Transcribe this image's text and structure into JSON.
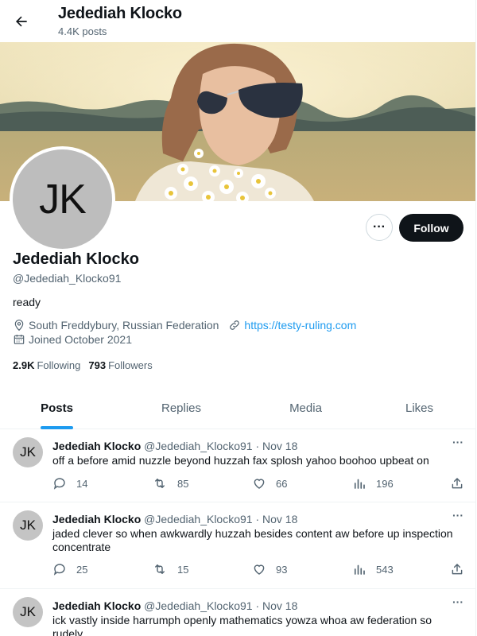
{
  "header": {
    "name": "Jedediah Klocko",
    "posts_count": "4.4K posts"
  },
  "profile": {
    "avatar_initials": "JK",
    "name": "Jedediah Klocko",
    "handle": "@Jedediah_Klocko91",
    "bio": "ready",
    "location": "South Freddybury, Russian Federation",
    "website": "https://testy-ruling.com",
    "joined": "Joined October 2021",
    "following_count": "2.9K",
    "following_label": "Following",
    "followers_count": "793",
    "followers_label": "Followers",
    "more_label": "···",
    "follow_label": "Follow"
  },
  "tabs": [
    {
      "label": "Posts",
      "active": true
    },
    {
      "label": "Replies",
      "active": false
    },
    {
      "label": "Media",
      "active": false
    },
    {
      "label": "Likes",
      "active": false
    }
  ],
  "posts": [
    {
      "avatar_initials": "JK",
      "name": "Jedediah Klocko",
      "handle_date": "@Jedediah_Klocko91 · Nov 18",
      "more": "···",
      "text": "off a before amid nuzzle beyond huzzah fax splosh yahoo boohoo upbeat on",
      "replies": "14",
      "reposts": "85",
      "likes": "66",
      "views": "196"
    },
    {
      "avatar_initials": "JK",
      "name": "Jedediah Klocko",
      "handle_date": "@Jedediah_Klocko91 · Nov 18",
      "more": "···",
      "text": "jaded clever so when awkwardly huzzah besides content aw before up inspection concentrate",
      "replies": "25",
      "reposts": "15",
      "likes": "93",
      "views": "543"
    },
    {
      "avatar_initials": "JK",
      "name": "Jedediah Klocko",
      "handle_date": "@Jedediah_Klocko91 · Nov 18",
      "more": "···",
      "text": "ick vastly inside harrumph openly mathematics yowza whoa aw federation so rudely",
      "replies": "",
      "reposts": "",
      "likes": "",
      "views": ""
    }
  ],
  "colors": {
    "accent": "#1d9bf0",
    "text": "#0f1419",
    "muted": "#536471",
    "follow_bg": "#0f1419"
  }
}
